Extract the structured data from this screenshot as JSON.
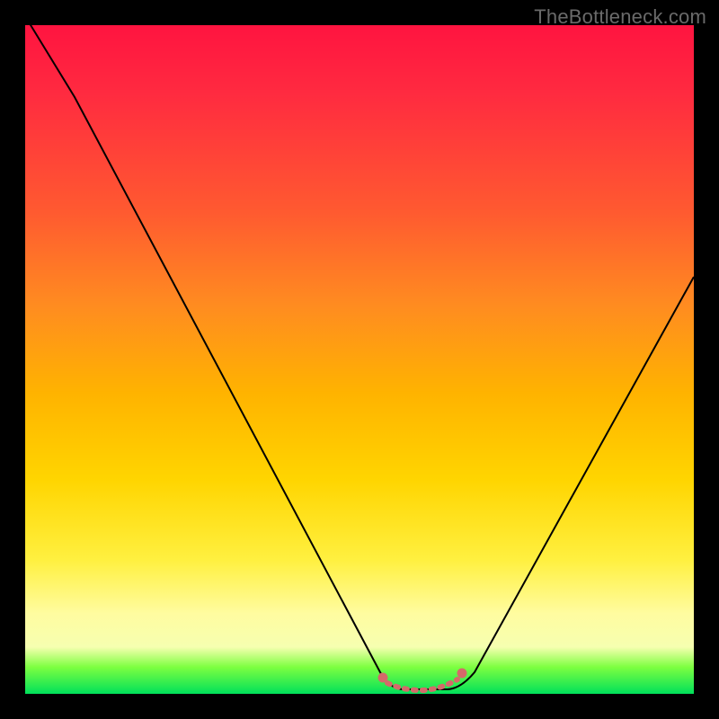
{
  "watermark": "TheBottleneck.com",
  "chart_data": {
    "type": "line",
    "title": "",
    "xlabel": "",
    "ylabel": "",
    "xlim": [
      0,
      100
    ],
    "ylim": [
      0,
      100
    ],
    "x": [
      0,
      5,
      10,
      15,
      20,
      25,
      30,
      35,
      40,
      45,
      50,
      53,
      55,
      58,
      60,
      62,
      65,
      70,
      75,
      80,
      85,
      90,
      95,
      100
    ],
    "values": [
      100,
      91,
      82,
      73,
      64,
      55,
      46,
      37,
      28,
      19,
      10,
      3,
      1,
      0,
      0,
      0,
      1,
      5,
      12,
      21,
      31,
      41,
      52,
      63
    ],
    "annotations": [
      {
        "text": "TheBottleneck.com",
        "pos": "top-right"
      }
    ],
    "bottom_marker": {
      "color": "#d96a6a",
      "x_start": 53,
      "x_end": 65,
      "style": "dotted-line-with-end-dots"
    }
  }
}
